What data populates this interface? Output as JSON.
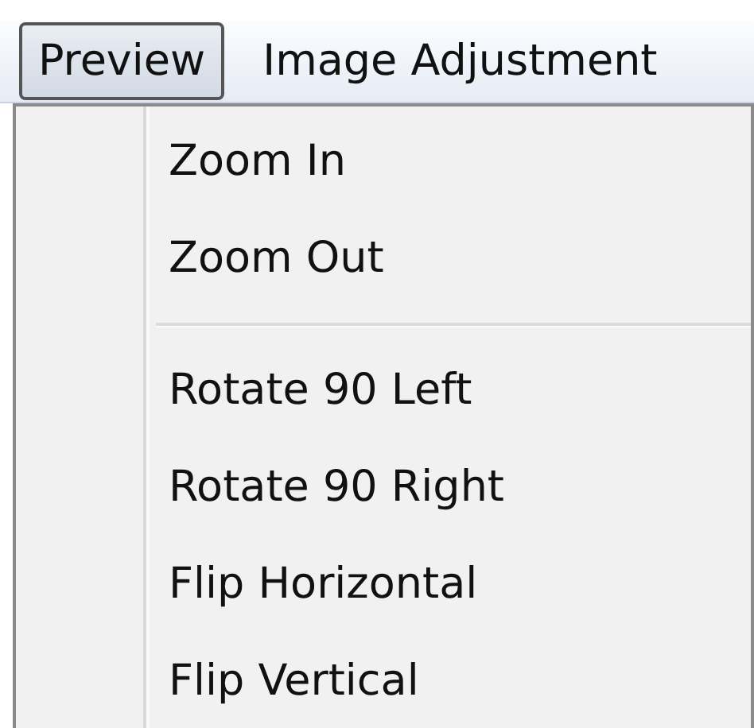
{
  "menu_bar": [
    {
      "label": "Preview",
      "selected": true
    },
    {
      "label": "Image Adjustment",
      "selected": false
    }
  ],
  "menu": {
    "items": [
      {
        "kind": "item",
        "label": "Zoom In"
      },
      {
        "kind": "item",
        "label": "Zoom Out"
      },
      {
        "kind": "separator"
      },
      {
        "kind": "item",
        "label": "Rotate 90 Left"
      },
      {
        "kind": "item",
        "label": "Rotate 90 Right"
      },
      {
        "kind": "item",
        "label": "Flip Horizontal"
      },
      {
        "kind": "item",
        "label": "Flip Vertical"
      }
    ]
  }
}
